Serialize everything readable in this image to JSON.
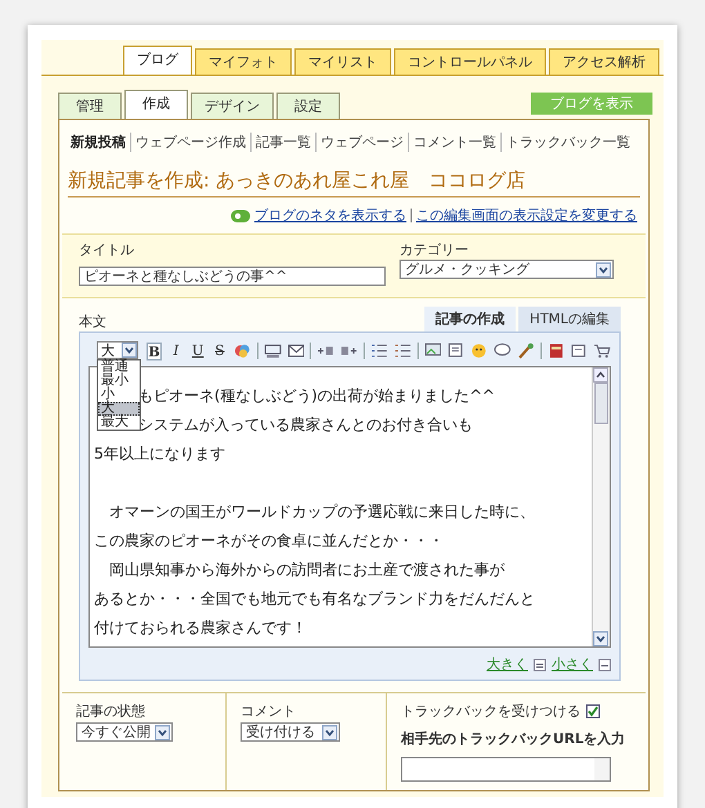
{
  "top_tabs": [
    {
      "label": "ブログ",
      "selected": true
    },
    {
      "label": "マイフォト",
      "selected": false
    },
    {
      "label": "マイリスト",
      "selected": false
    },
    {
      "label": "コントロールパネル",
      "selected": false
    },
    {
      "label": "アクセス解析",
      "selected": false
    }
  ],
  "section_tabs": [
    {
      "label": "管理",
      "selected": false
    },
    {
      "label": "作成",
      "selected": true
    },
    {
      "label": "デザイン",
      "selected": false
    },
    {
      "label": "設定",
      "selected": false
    }
  ],
  "view_blog_button": "ブログを表示",
  "sub_nav": [
    {
      "label": "新規投稿",
      "selected": true
    },
    {
      "label": "ウェブページ作成",
      "selected": false
    },
    {
      "label": "記事一覧",
      "selected": false
    },
    {
      "label": "ウェブページ",
      "selected": false
    },
    {
      "label": "コメント一覧",
      "selected": false
    },
    {
      "label": "トラックバック一覧",
      "selected": false
    }
  ],
  "heading": "新規記事を作成: あっきのあれ屋これ屋　ココログ店",
  "help_links": [
    "ブログのネタを表示する",
    "この編集画面の表示設定を変更する"
  ],
  "title_field": {
    "label": "タイトル",
    "value": "ピオーネと種なしぶどうの事^^"
  },
  "category": {
    "label": "カテゴリー",
    "value": "グルメ・クッキング"
  },
  "body": {
    "label": "本文",
    "tabs": [
      {
        "label": "記事の作成",
        "selected": true
      },
      {
        "label": "HTMLの編集",
        "selected": false
      }
    ],
    "font_size": {
      "value": "大",
      "expanded": true,
      "options": [
        {
          "label": "普通",
          "selected": false
        },
        {
          "label": "最小",
          "selected": false
        },
        {
          "label": "小",
          "selected": false
        },
        {
          "label": "大",
          "selected": true
        },
        {
          "label": "最大",
          "selected": false
        }
      ]
    },
    "format_buttons": [
      "B",
      "I",
      "U",
      "S"
    ],
    "lines": [
      {
        "kind": "cut",
        "text": "もピオーネ(種なしぶどう)の出荷が始まりました^^"
      },
      {
        "kind": "cut",
        "text": "システムが入っている農家さんとのお付き合いも"
      },
      {
        "kind": "line",
        "text": "5年以上になります"
      },
      {
        "kind": "gap"
      },
      {
        "kind": "line",
        "text": "　オマーンの国王がワールドカップの予選応戦に来日した時に、"
      },
      {
        "kind": "line",
        "text": "この農家のピオーネがその食卓に並んだとか・・・"
      },
      {
        "kind": "line",
        "text": "　岡山県知事から海外からの訪問者にお土産で渡された事が"
      },
      {
        "kind": "line",
        "text": "あるとか・・・全国でも地元でも有名なブランド力をだんだんと"
      },
      {
        "kind": "line",
        "text": "付けておられる農家さんです！"
      }
    ],
    "resize_links": [
      "大きく",
      "小さく"
    ]
  },
  "status": {
    "label": "記事の状態",
    "value": "今すぐ公開"
  },
  "comment": {
    "label": "コメント",
    "value": "受け付ける"
  },
  "trackback": {
    "label": "トラックバックを受けつける",
    "checked": true,
    "url_label": "相手先のトラックバックURLを入力"
  }
}
